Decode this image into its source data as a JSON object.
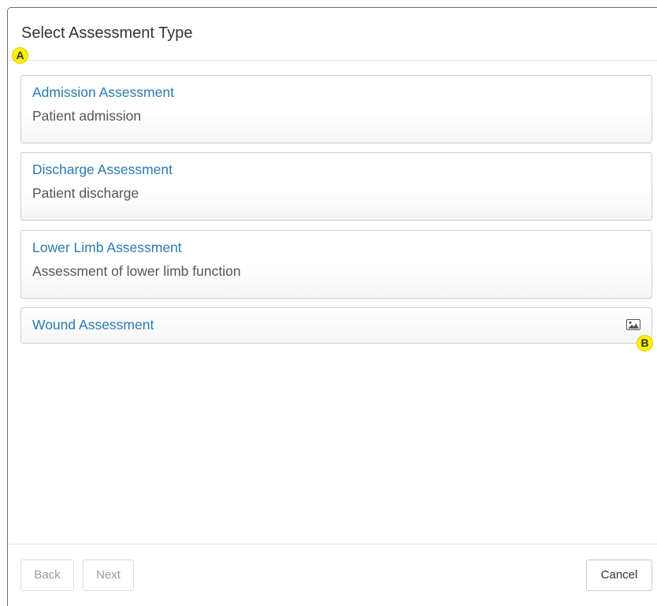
{
  "dialog": {
    "title": "Select Assessment Type"
  },
  "markers": {
    "a": "A",
    "b": "B"
  },
  "assessments": [
    {
      "title": "Admission Assessment",
      "description": "Patient admission"
    },
    {
      "title": "Discharge Assessment",
      "description": "Patient discharge"
    },
    {
      "title": "Lower Limb Assessment",
      "description": "Assessment of lower limb function"
    },
    {
      "title": "Wound Assessment",
      "icon": "image-icon"
    }
  ],
  "footer": {
    "back_label": "Back",
    "next_label": "Next",
    "cancel_label": "Cancel",
    "back_disabled": true,
    "next_disabled": true
  },
  "colors": {
    "link": "#2a7ab0",
    "marker": "#fff200"
  }
}
